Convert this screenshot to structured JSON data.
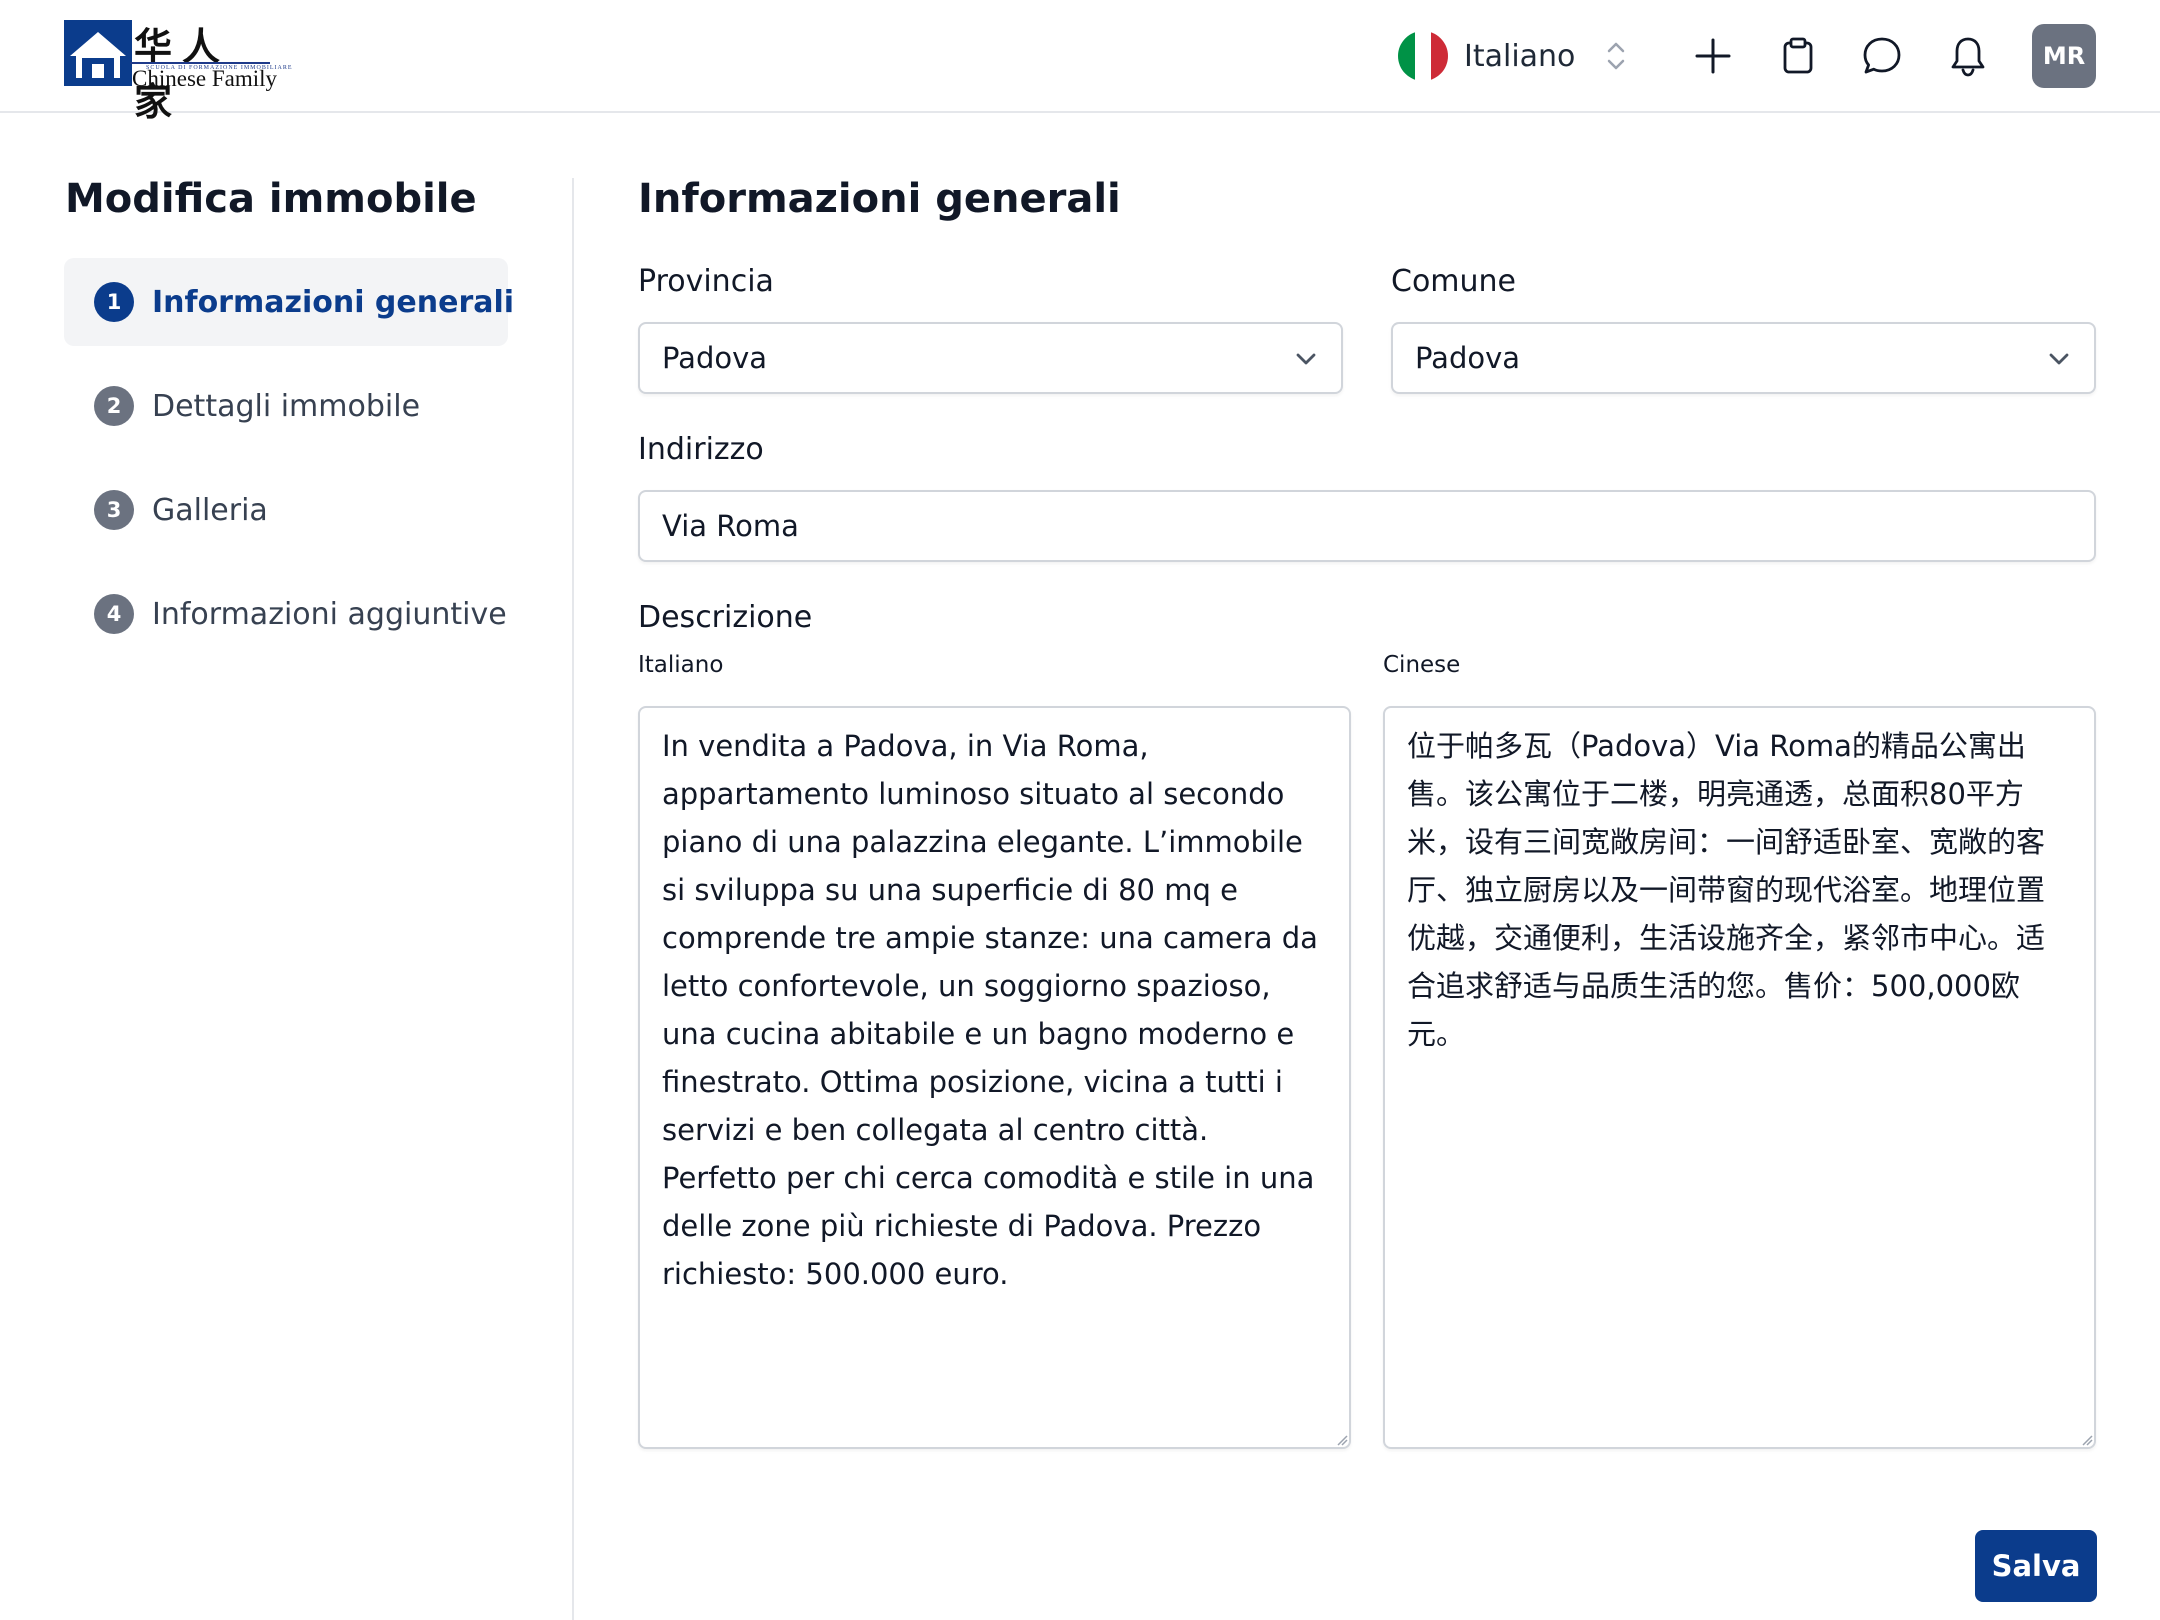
{
  "header": {
    "logo": {
      "chinese": "华人家",
      "small_text": "SCUOLA DI FORMAZIONE IMMOBILIARE",
      "english": "Chinese Family"
    },
    "language": {
      "label": "Italiano",
      "flag_colors": [
        "#009246",
        "#ffffff",
        "#ce2b37"
      ]
    },
    "icons": [
      "plus-icon",
      "clipboard-icon",
      "chat-icon",
      "bell-icon"
    ],
    "avatar_initials": "MR"
  },
  "sidebar": {
    "title": "Modifica immobile",
    "steps": [
      {
        "num": "1",
        "label": "Informazioni generali",
        "active": true
      },
      {
        "num": "2",
        "label": "Dettagli immobile",
        "active": false
      },
      {
        "num": "3",
        "label": "Galleria",
        "active": false
      },
      {
        "num": "4",
        "label": "Informazioni aggiuntive",
        "active": false
      }
    ]
  },
  "form": {
    "title": "Informazioni generali",
    "provincia": {
      "label": "Provincia",
      "value": "Padova"
    },
    "comune": {
      "label": "Comune",
      "value": "Padova"
    },
    "indirizzo": {
      "label": "Indirizzo",
      "value": "Via Roma"
    },
    "descrizione": {
      "label": "Descrizione",
      "italiano": {
        "label": "Italiano",
        "value": "In vendita a Padova, in Via Roma, appartamento luminoso situato al secondo piano di una palazzina elegante. L’immobile si sviluppa su una superficie di 80 mq e comprende tre ampie stanze: una camera da letto confortevole, un soggiorno spazioso, una cucina abitabile e un bagno moderno e finestrato. Ottima posizione, vicina a tutti i servizi e ben collegata al centro città. Perfetto per chi cerca comodità e stile in una delle zone più richieste di Padova. Prezzo richiesto: 500.000 euro."
      },
      "cinese": {
        "label": "Cinese",
        "value": "位于帕多瓦（Padova）Via Roma的精品公寓出售。该公寓位于二楼，明亮通透，总面积80平方米，设有三间宽敞房间：一间舒适卧室、宽敞的客厅、独立厨房以及一间带窗的现代浴室。地理位置优越，交通便利，生活设施齐全，紧邻市中心。适合追求舒适与品质生活的您。售价：500,000欧元。"
      }
    },
    "save_label": "Salva"
  },
  "colors": {
    "accent": "#0b3c8c",
    "step_inactive": "#6b7280",
    "border": "#d1d5db"
  }
}
